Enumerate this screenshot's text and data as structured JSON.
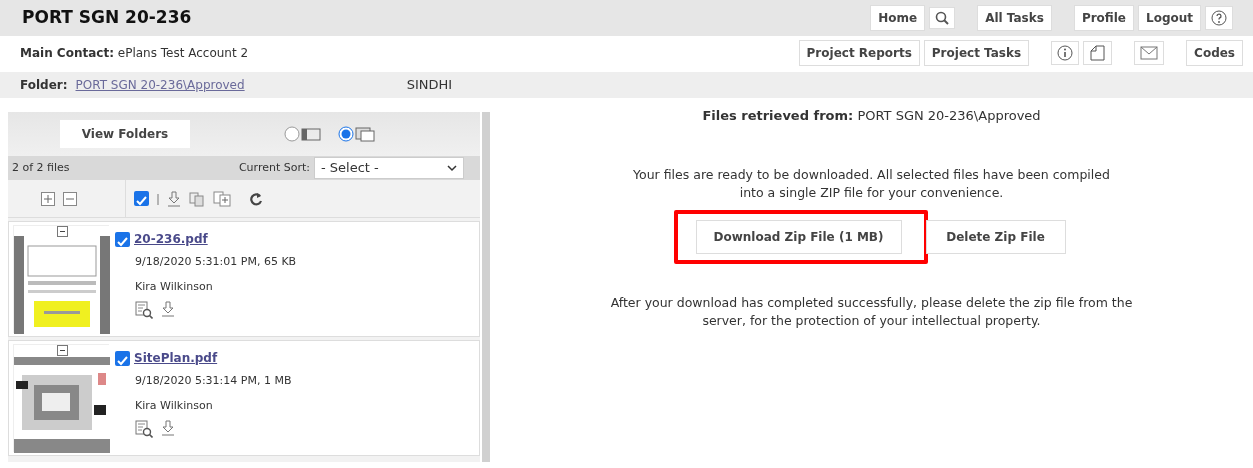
{
  "header": {
    "title": "PORT SGN 20-236",
    "nav_buttons": [
      {
        "kind": "text",
        "label": "Home"
      },
      {
        "kind": "search"
      },
      {
        "kind": "gap"
      },
      {
        "kind": "text",
        "label": "All Tasks"
      },
      {
        "kind": "gap"
      },
      {
        "kind": "text",
        "label": "Profile"
      },
      {
        "kind": "text",
        "label": "Logout"
      },
      {
        "kind": "help"
      }
    ]
  },
  "contact": {
    "label": "Main Contact:",
    "value": "ePlans Test Account 2",
    "buttons": [
      {
        "kind": "text",
        "label": "Project Reports"
      },
      {
        "kind": "text",
        "label": "Project Tasks"
      },
      {
        "kind": "gap"
      },
      {
        "kind": "info"
      },
      {
        "kind": "note"
      },
      {
        "kind": "gap"
      },
      {
        "kind": "mail"
      },
      {
        "kind": "gap"
      },
      {
        "kind": "text",
        "label": "Codes"
      }
    ]
  },
  "folder_bar": {
    "label": "Folder:",
    "path": "PORT SGN 20-236\\Approved",
    "user": "SINDHI"
  },
  "file_panel": {
    "view_folders": "View Folders",
    "view_options": [
      {
        "selected": false
      },
      {
        "selected": true
      }
    ],
    "count": "2 of 2 files",
    "sort_label": "Current Sort:",
    "sort_value": "- Select -",
    "select_all": {
      "checked": true
    },
    "files": [
      {
        "name": "20-236.pdf",
        "meta": "9/18/2020 5:31:01 PM, 65 KB",
        "author": "Kira Wilkinson",
        "checked": true,
        "kind": "form"
      },
      {
        "name": "SitePlan.pdf",
        "meta": "9/18/2020 5:31:14 PM, 1 MB",
        "author": "Kira Wilkinson",
        "checked": true,
        "kind": "plan"
      }
    ]
  },
  "download": {
    "source_label": "Files retrieved from:",
    "source": "PORT SGN 20-236\\Approved",
    "message": "Your files are ready to be downloaded. All selected files have been compiled into a single ZIP file for your convenience.",
    "buttons": [
      {
        "label": "Download Zip File (1 MB)",
        "highlighted": true
      },
      {
        "label": "Delete Zip File",
        "highlighted": false
      }
    ],
    "note": "After your download has completed successfully, please delete the zip file from the server, for the protection of your intellectual property."
  }
}
